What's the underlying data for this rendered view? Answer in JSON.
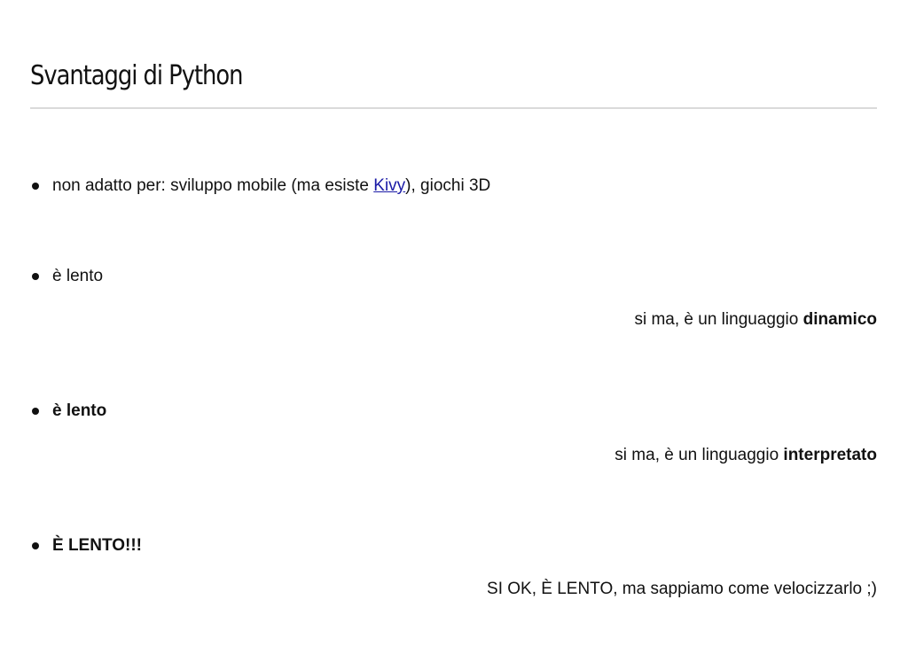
{
  "slide": {
    "title": "Svantaggi di Python",
    "items": [
      {
        "text_before": "non adatto per: sviluppo mobile (ma esiste ",
        "link": "Kivy",
        "text_after": "), giochi 3D"
      },
      {
        "text": "è lento",
        "note_prefix": "si ma, è un linguaggio ",
        "note_bold": "dinamico"
      },
      {
        "text": "è lento",
        "note_prefix": "si ma, è un linguaggio ",
        "note_bold": "interpretato"
      },
      {
        "text": "È LENTO!!!",
        "note": "SI OK, È LENTO, ma sappiamo come velocizzarlo ;)"
      }
    ]
  },
  "colors": {
    "text": "#111111",
    "link": "#1a1aa6",
    "rule": "#dadada",
    "background": "#ffffff"
  }
}
